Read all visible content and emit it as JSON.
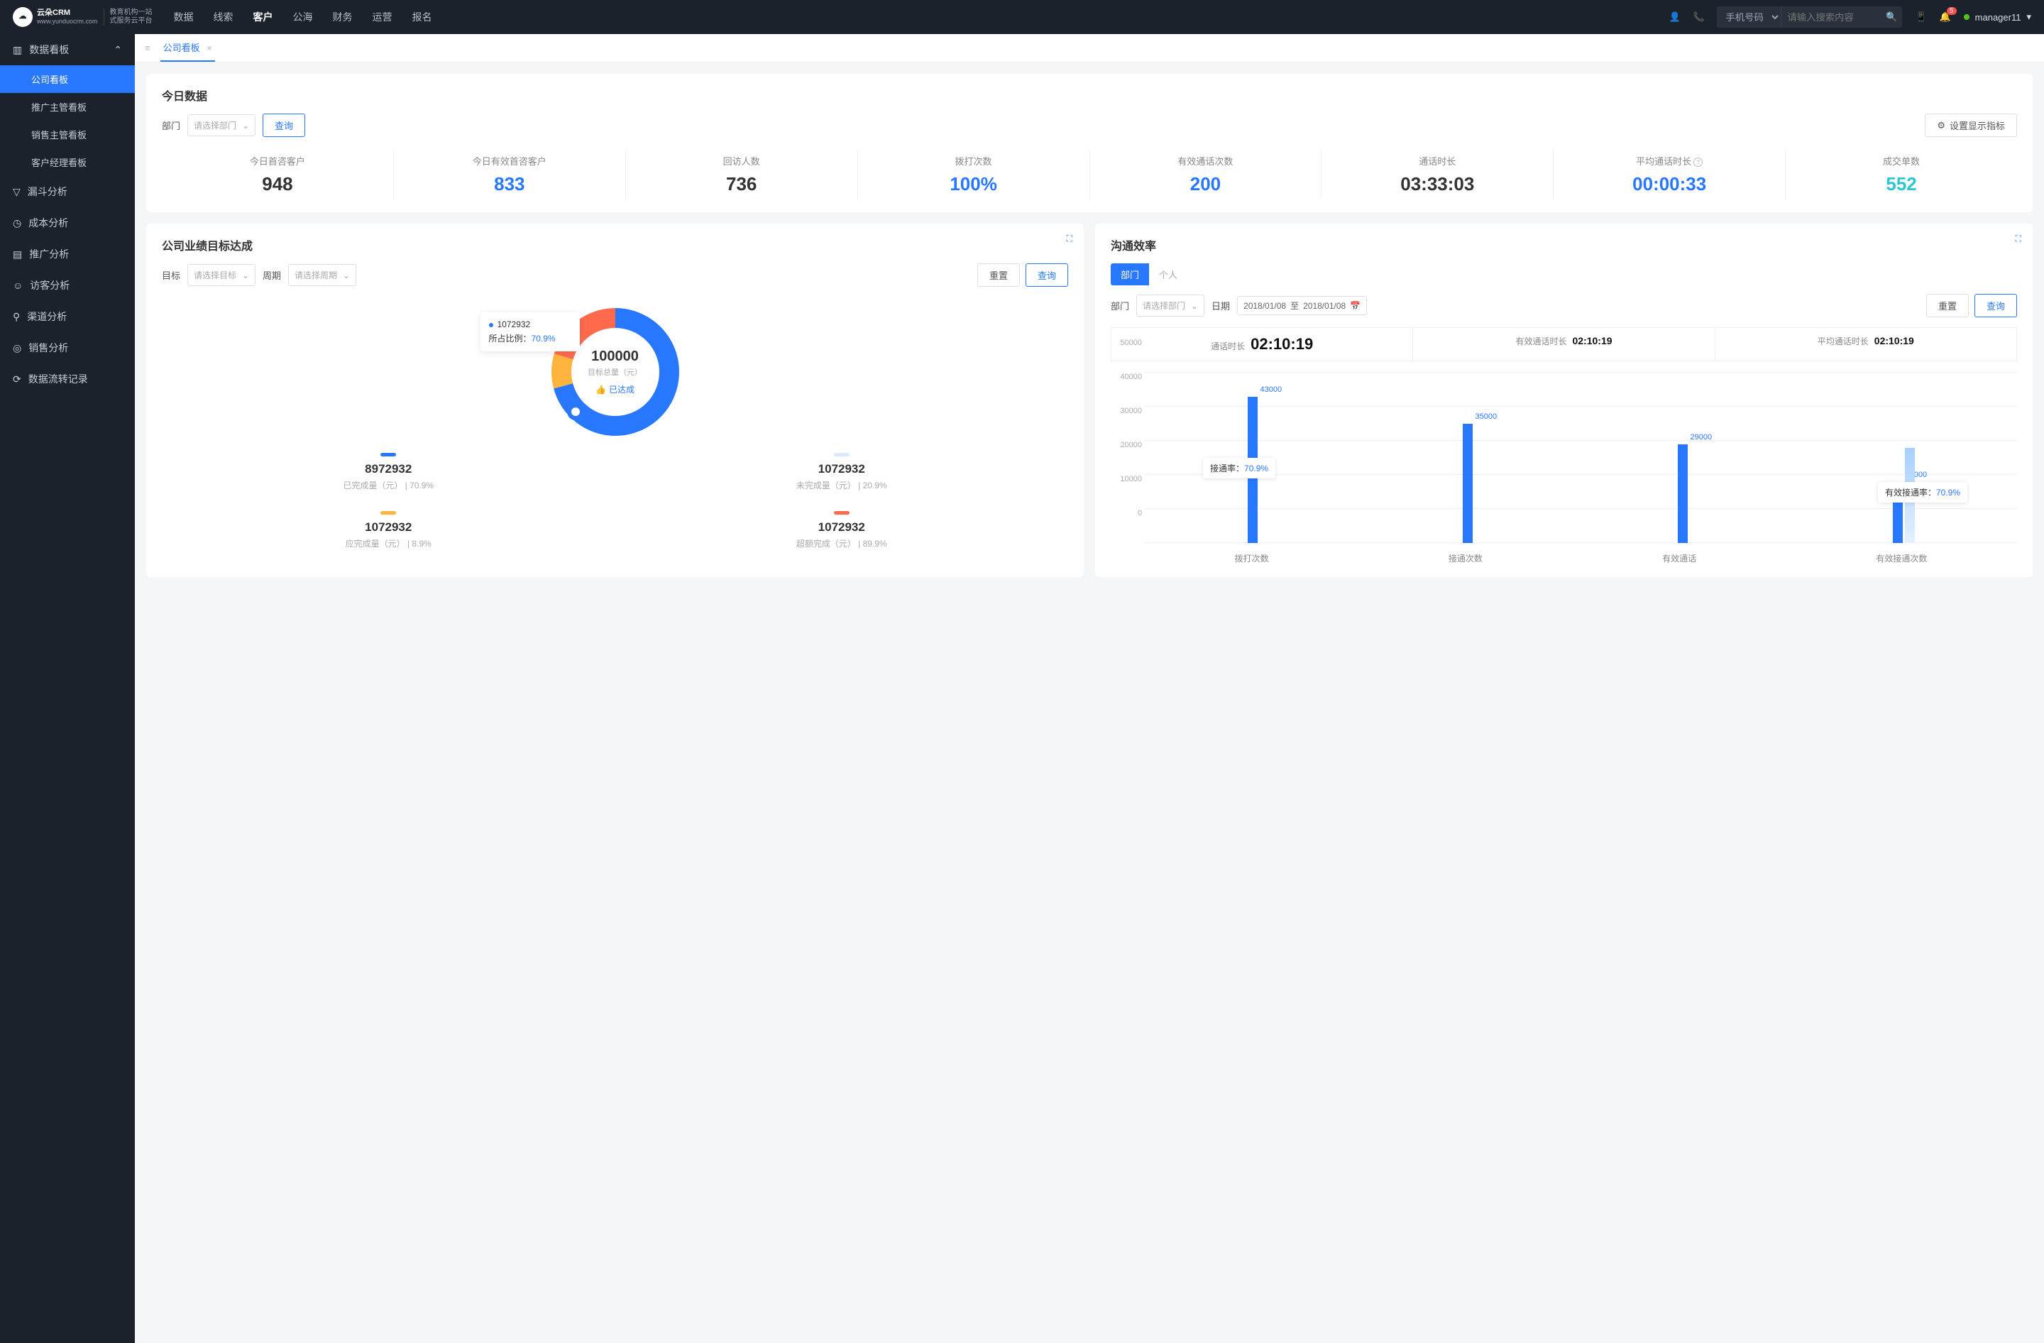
{
  "brand": {
    "name": "云朵CRM",
    "slogan1": "教育机构一站",
    "slogan2": "式服务云平台",
    "domain": "www.yunduocrm.com"
  },
  "topnav": [
    "数据",
    "线索",
    "客户",
    "公海",
    "财务",
    "运营",
    "报名"
  ],
  "topnav_active": 2,
  "search": {
    "type": "手机号码",
    "placeholder": "请输入搜索内容"
  },
  "notif_count": "5",
  "user": "manager11",
  "sidebar": {
    "group": "数据看板",
    "subs": [
      "公司看板",
      "推广主管看板",
      "销售主管看板",
      "客户经理看板"
    ],
    "sub_active": 0,
    "items": [
      "漏斗分析",
      "成本分析",
      "推广分析",
      "访客分析",
      "渠道分析",
      "销售分析",
      "数据流转记录"
    ]
  },
  "tabs": [
    "公司看板"
  ],
  "today": {
    "title": "今日数据",
    "filter_label": "部门",
    "filter_placeholder": "请选择部门",
    "query": "查询",
    "settings": "设置显示指标",
    "stats": [
      {
        "label": "今日首咨客户",
        "value": "948",
        "cls": ""
      },
      {
        "label": "今日有效首咨客户",
        "value": "833",
        "cls": "blue"
      },
      {
        "label": "回访人数",
        "value": "736",
        "cls": ""
      },
      {
        "label": "拨打次数",
        "value": "100%",
        "cls": "blue"
      },
      {
        "label": "有效通话次数",
        "value": "200",
        "cls": "blue"
      },
      {
        "label": "通话时长",
        "value": "03:33:03",
        "cls": ""
      },
      {
        "label": "平均通话时长",
        "value": "00:00:33",
        "cls": "blue",
        "info": true
      },
      {
        "label": "成交单数",
        "value": "552",
        "cls": "cyan"
      }
    ]
  },
  "goal": {
    "title": "公司业绩目标达成",
    "target_label": "目标",
    "target_placeholder": "请选择目标",
    "period_label": "周期",
    "period_placeholder": "请选择周期",
    "reset": "重置",
    "query": "查询",
    "center_value": "100000",
    "center_sub": "目标总量（元）",
    "status": "已达成",
    "tooltip_value": "1072932",
    "tooltip_pct_label": "所占比例：",
    "tooltip_pct": "70.9%",
    "legends": [
      {
        "color": "#2878ff",
        "value": "8972932",
        "sub": "已完成量（元）",
        "pct": "70.9%"
      },
      {
        "color": "#dbe9ff",
        "value": "1072932",
        "sub": "未完成量（元）",
        "pct": "20.9%"
      },
      {
        "color": "#ffb53d",
        "value": "1072932",
        "sub": "应完成量（元）",
        "pct": "8.9%"
      },
      {
        "color": "#ff6a4d",
        "value": "1072932",
        "sub": "超额完成（元）",
        "pct": "89.9%"
      }
    ]
  },
  "eff": {
    "title": "沟通效率",
    "seg": [
      "部门",
      "个人"
    ],
    "seg_active": 0,
    "filter_label": "部门",
    "filter_placeholder": "请选择部门",
    "date_label": "日期",
    "date_from": "2018/01/08",
    "date_to": "2018/01/08",
    "date_sep": "至",
    "reset": "重置",
    "query": "查询",
    "summary": [
      {
        "label": "通话时长",
        "value": "02:10:19"
      },
      {
        "label": "有效通话时长",
        "value": "02:10:19"
      },
      {
        "label": "平均通话时长",
        "value": "02:10:19"
      }
    ],
    "annotations": [
      {
        "label": "接通率：",
        "value": "70.9%"
      },
      {
        "label": "有效接通率：",
        "value": "70.9%"
      }
    ]
  },
  "chart_data": {
    "type": "bar",
    "categories": [
      "拨打次数",
      "接通次数",
      "有效通话",
      "有效接通次数"
    ],
    "series": [
      {
        "name": "main",
        "values": [
          43000,
          35000,
          29000,
          18000
        ]
      },
      {
        "name": "secondary",
        "values": [
          null,
          null,
          null,
          28000
        ]
      }
    ],
    "y_ticks": [
      0,
      10000,
      20000,
      30000,
      40000,
      50000
    ],
    "ylim": [
      0,
      50000
    ],
    "labels": [
      "43000",
      "35000",
      "29000",
      "18000"
    ]
  }
}
